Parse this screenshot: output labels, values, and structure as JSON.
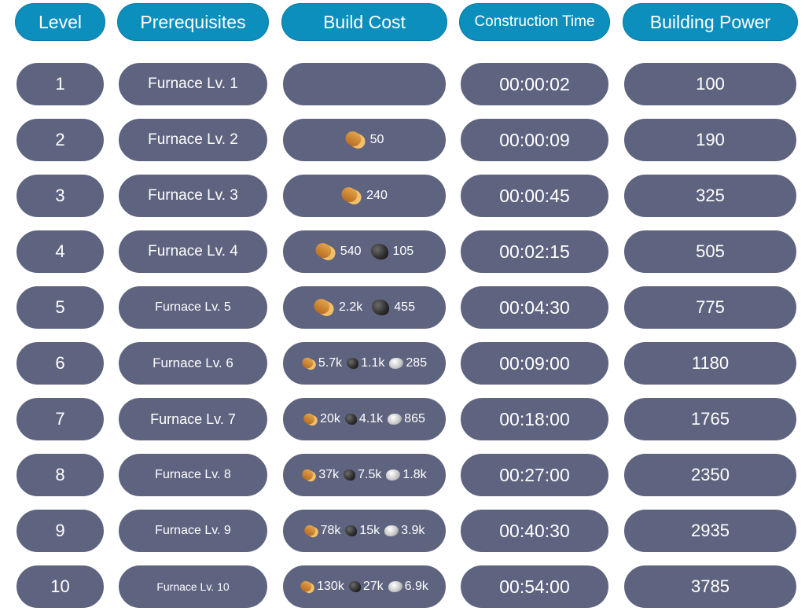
{
  "headers": {
    "level": "Level",
    "prerequisites": "Prerequisites",
    "build_cost": "Build Cost",
    "construction_time": "Construction Time",
    "building_power": "Building Power"
  },
  "icons": {
    "wood": "wood-log-icon",
    "coal": "coal-icon",
    "iron": "iron-ore-icon"
  },
  "colors": {
    "header_bg": "#0c8fbd",
    "cell_bg": "#5e6480",
    "text": "#ffffff"
  },
  "rows": [
    {
      "level": "1",
      "prereq": "Furnace Lv. 1",
      "cost": {
        "wood": "",
        "coal": "",
        "iron": ""
      },
      "time": "00:00:02",
      "power": "100"
    },
    {
      "level": "2",
      "prereq": "Furnace Lv. 2",
      "cost": {
        "wood": "50",
        "coal": "",
        "iron": ""
      },
      "time": "00:00:09",
      "power": "190"
    },
    {
      "level": "3",
      "prereq": "Furnace Lv. 3",
      "cost": {
        "wood": "240",
        "coal": "",
        "iron": ""
      },
      "time": "00:00:45",
      "power": "325"
    },
    {
      "level": "4",
      "prereq": "Furnace Lv. 4",
      "cost": {
        "wood": "540",
        "coal": "105",
        "iron": ""
      },
      "time": "00:02:15",
      "power": "505"
    },
    {
      "level": "5",
      "prereq": "Furnace Lv. 5",
      "cost": {
        "wood": "2.2k",
        "coal": "455",
        "iron": ""
      },
      "time": "00:04:30",
      "power": "775"
    },
    {
      "level": "6",
      "prereq": "Furnace Lv. 6",
      "cost": {
        "wood": "5.7k",
        "coal": "1.1k",
        "iron": "285"
      },
      "time": "00:09:00",
      "power": "1180"
    },
    {
      "level": "7",
      "prereq": "Furnace Lv. 7",
      "cost": {
        "wood": "20k",
        "coal": "4.1k",
        "iron": "865"
      },
      "time": "00:18:00",
      "power": "1765"
    },
    {
      "level": "8",
      "prereq": "Furnace Lv. 8",
      "cost": {
        "wood": "37k",
        "coal": "7.5k",
        "iron": "1.8k"
      },
      "time": "00:27:00",
      "power": "2350"
    },
    {
      "level": "9",
      "prereq": "Furnace Lv. 9",
      "cost": {
        "wood": "78k",
        "coal": "15k",
        "iron": "3.9k"
      },
      "time": "00:40:30",
      "power": "2935"
    },
    {
      "level": "10",
      "prereq": "Furnace Lv. 10",
      "cost": {
        "wood": "130k",
        "coal": "27k",
        "iron": "6.9k"
      },
      "time": "00:54:00",
      "power": "3785"
    }
  ]
}
